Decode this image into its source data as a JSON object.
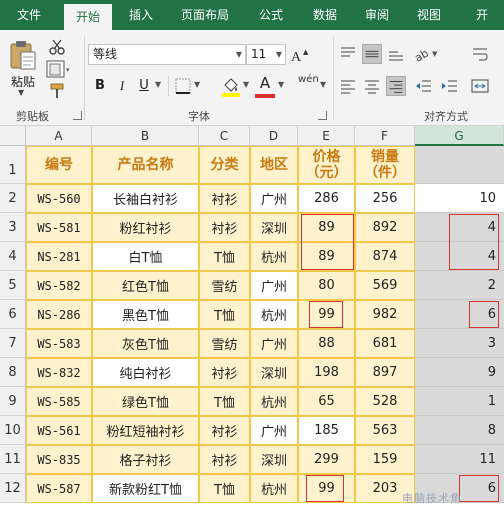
{
  "ribbon_tabs": [
    "文件",
    "开始",
    "插入",
    "页面布局",
    "公式",
    "数据",
    "审阅",
    "视图",
    "开"
  ],
  "active_tab": "开始",
  "clipboard": {
    "paste_label": "粘贴",
    "group_label": "剪贴板"
  },
  "font": {
    "name": "等线",
    "size": "11",
    "group_label": "字体",
    "bold": "B",
    "italic": "I",
    "underline": "U",
    "font_color_letter": "A",
    "phonetic": "wén"
  },
  "alignment": {
    "group_label": "对齐方式"
  },
  "colors": {
    "accent": "#217346",
    "header_text": "#c97a12",
    "cell_fill": "#fff2cc",
    "cell_border": "#f0c84a",
    "highlight_box": "#d9342b",
    "font_color_bar": "#e02b2b",
    "fill_color_bar": "#ffff00"
  },
  "columns": [
    "A",
    "B",
    "C",
    "D",
    "E",
    "F",
    "G"
  ],
  "row_numbers": [
    "1",
    "2",
    "3",
    "4",
    "5",
    "6",
    "7",
    "8",
    "9",
    "10",
    "11",
    "12"
  ],
  "headers": {
    "code": "编号",
    "name": "产品名称",
    "category": "分类",
    "region_line1": "地区",
    "price_line1": "价格",
    "price_line2": "（元）",
    "sales_line1": "销量",
    "sales_line2": "（件）"
  },
  "rows": [
    {
      "code": "WS-560",
      "name": "长袖白衬衫",
      "category": "衬衫",
      "region": "广州",
      "price": "286",
      "sales": "256",
      "g": "10"
    },
    {
      "code": "WS-581",
      "name": "粉红衬衫",
      "category": "衬衫",
      "region": "深圳",
      "price": "89",
      "sales": "892",
      "g": "4"
    },
    {
      "code": "NS-281",
      "name": "白T恤",
      "category": "T恤",
      "region": "杭州",
      "price": "89",
      "sales": "874",
      "g": "4"
    },
    {
      "code": "WS-582",
      "name": "红色T恤",
      "category": "雪纺",
      "region": "广州",
      "price": "80",
      "sales": "569",
      "g": "2"
    },
    {
      "code": "NS-286",
      "name": "黑色T恤",
      "category": "T恤",
      "region": "杭州",
      "price": "99",
      "sales": "982",
      "g": "6"
    },
    {
      "code": "WS-583",
      "name": "灰色T恤",
      "category": "雪纺",
      "region": "广州",
      "price": "88",
      "sales": "681",
      "g": "3"
    },
    {
      "code": "WS-832",
      "name": "纯白衬衫",
      "category": "衬衫",
      "region": "深圳",
      "price": "198",
      "sales": "897",
      "g": "9"
    },
    {
      "code": "WS-585",
      "name": "绿色T恤",
      "category": "T恤",
      "region": "杭州",
      "price": "65",
      "sales": "528",
      "g": "1"
    },
    {
      "code": "WS-561",
      "name": "粉红短袖衬衫",
      "category": "衬衫",
      "region": "广州",
      "price": "185",
      "sales": "563",
      "g": "8"
    },
    {
      "code": "WS-835",
      "name": "格子衬衫",
      "category": "衬衫",
      "region": "深圳",
      "price": "299",
      "sales": "159",
      "g": "11"
    },
    {
      "code": "WS-587",
      "name": "新款粉红T恤",
      "category": "T恤",
      "region": "杭州",
      "price": "99",
      "sales": "203",
      "g": "6"
    }
  ],
  "watermark": "电脑技术角"
}
